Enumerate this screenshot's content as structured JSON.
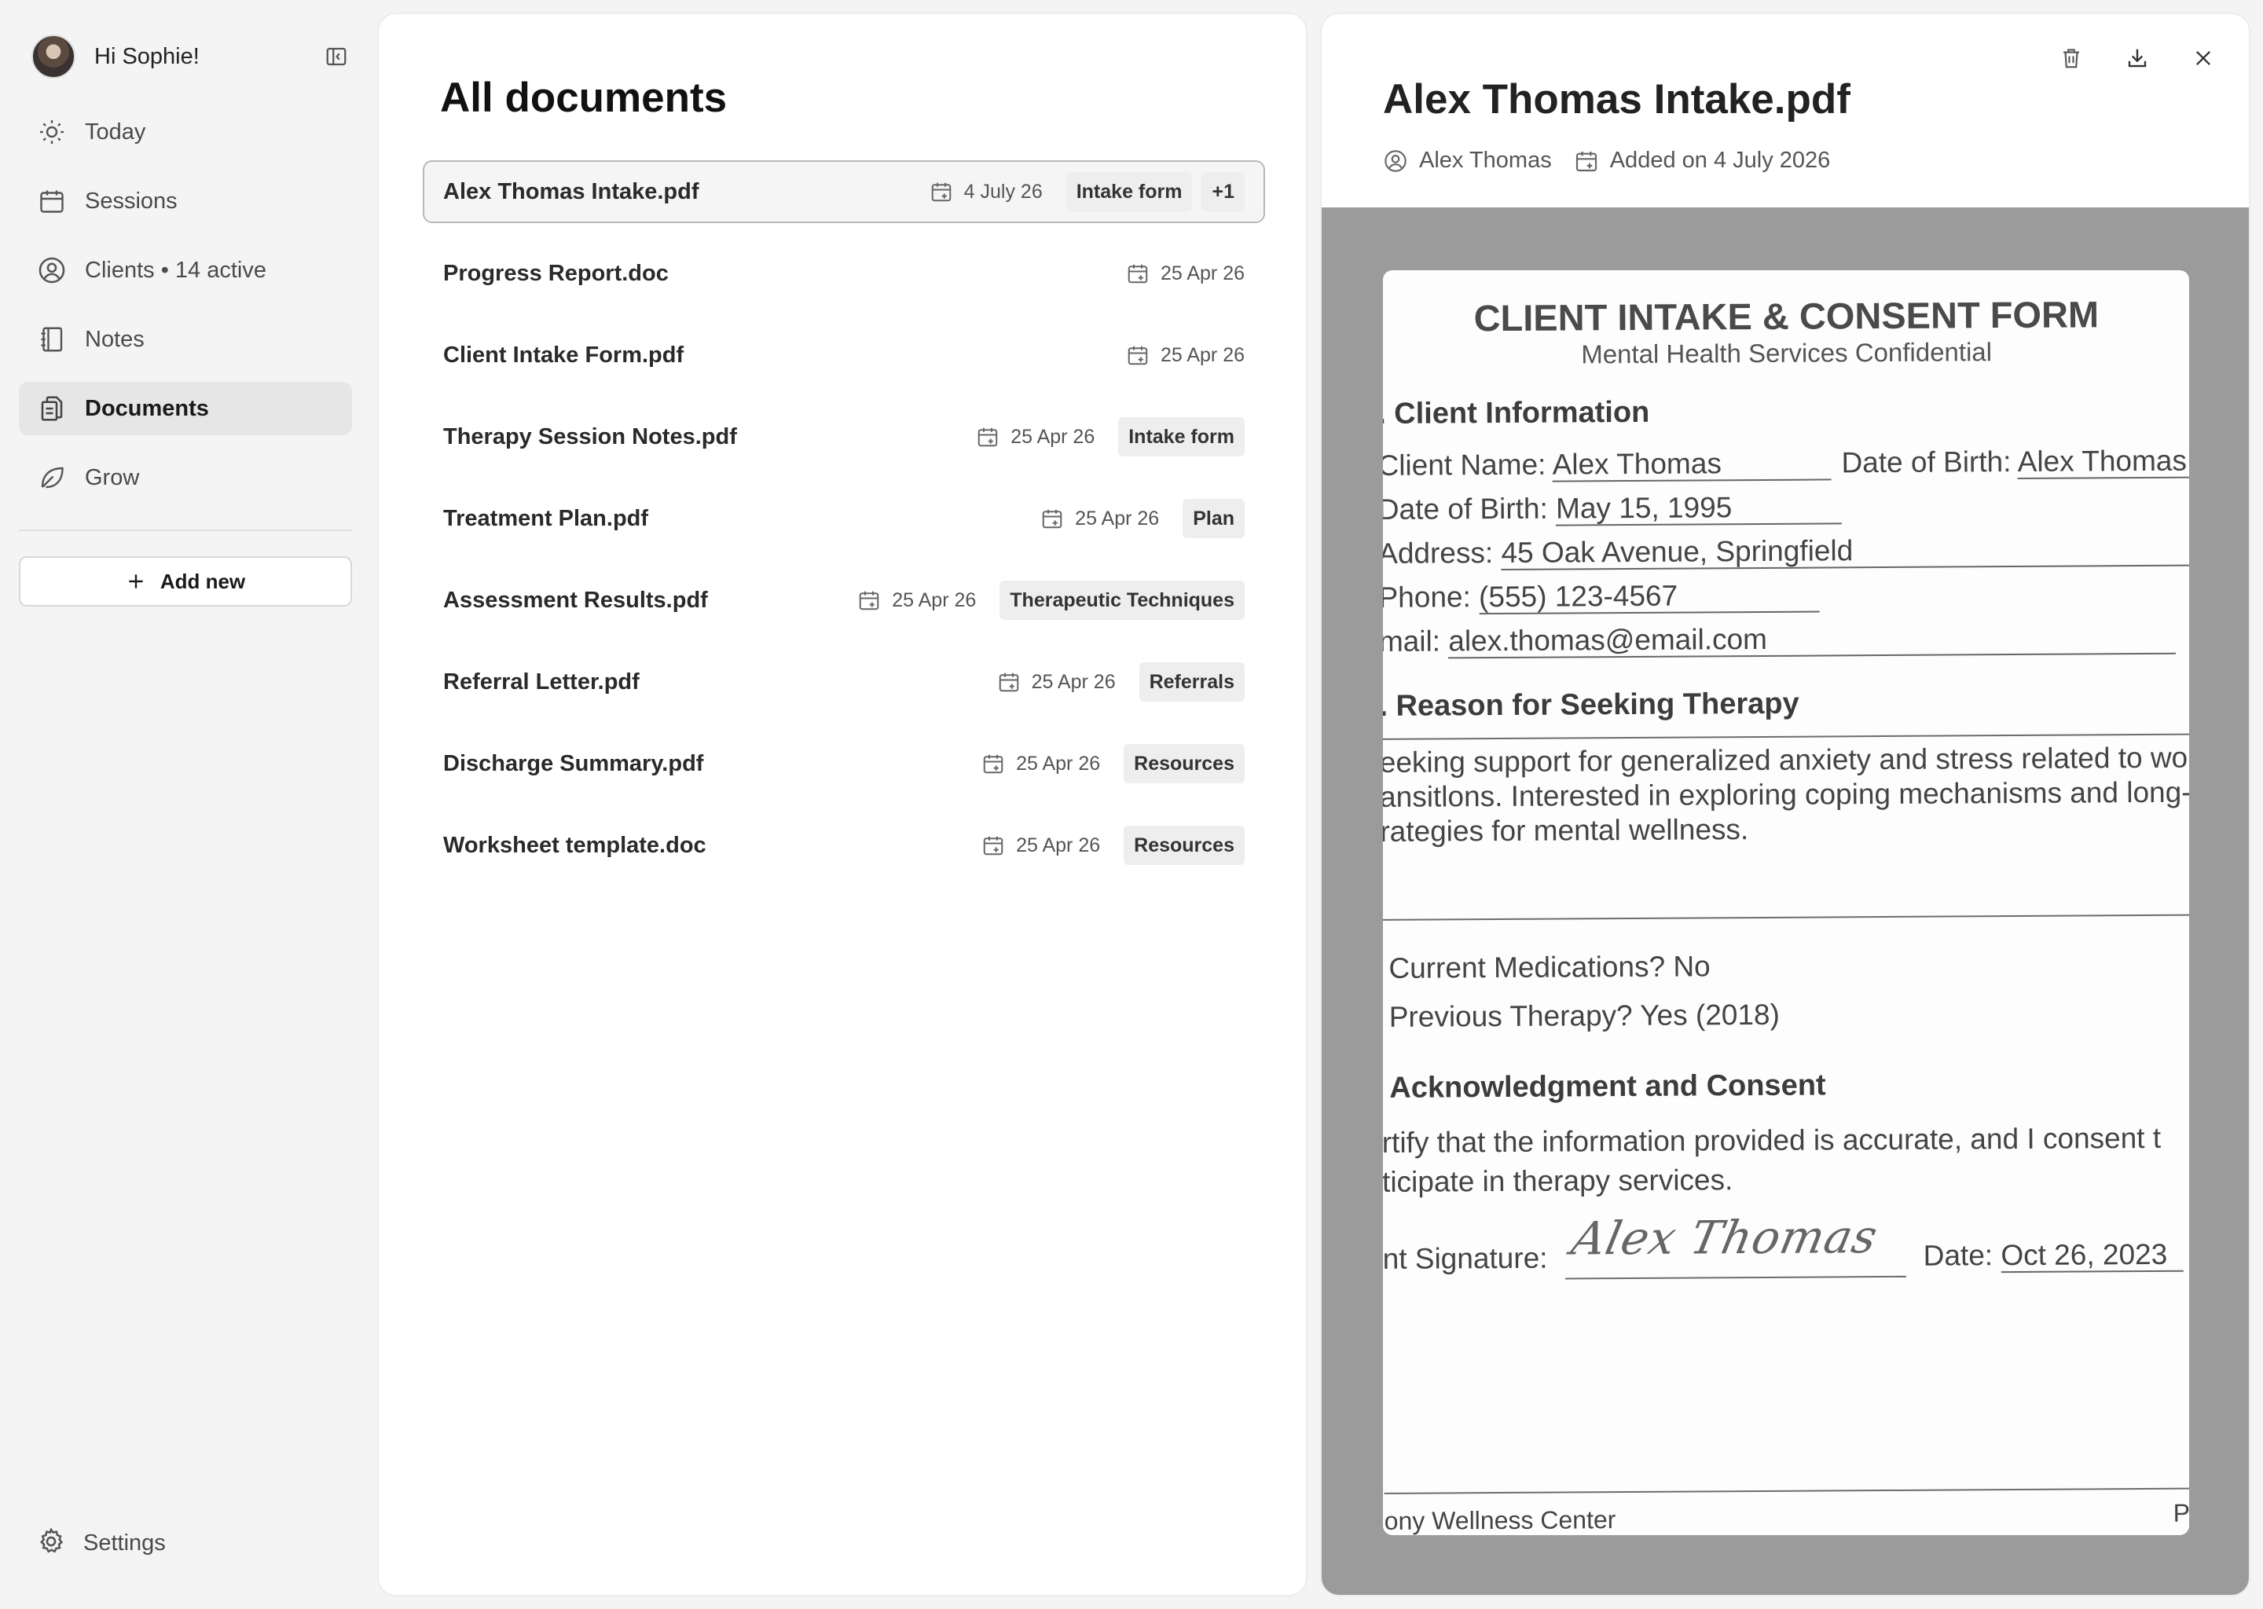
{
  "sidebar": {
    "greeting": "Hi Sophie!",
    "nav": [
      {
        "label": "Today",
        "icon": "sun-icon"
      },
      {
        "label": "Sessions",
        "icon": "calendar-icon"
      },
      {
        "label": "Clients • 14 active",
        "icon": "user-circle-icon"
      },
      {
        "label": "Notes",
        "icon": "notebook-icon"
      },
      {
        "label": "Documents",
        "icon": "documents-icon",
        "active": true
      },
      {
        "label": "Grow",
        "icon": "leaf-icon"
      }
    ],
    "add_new_label": "Add new",
    "settings_label": "Settings"
  },
  "list": {
    "title": "All documents",
    "documents": [
      {
        "name": "Alex Thomas Intake.pdf",
        "date": "4 July 26",
        "tags": [
          "Intake form",
          "+1"
        ],
        "selected": true
      },
      {
        "name": "Progress Report.doc",
        "date": "25 Apr 26",
        "tags": []
      },
      {
        "name": "Client Intake Form.pdf",
        "date": "25 Apr 26",
        "tags": []
      },
      {
        "name": "Therapy Session Notes.pdf",
        "date": "25 Apr 26",
        "tags": [
          "Intake form"
        ]
      },
      {
        "name": "Treatment Plan.pdf",
        "date": "25 Apr 26",
        "tags": [
          "Plan"
        ]
      },
      {
        "name": "Assessment Results.pdf",
        "date": "25 Apr 26",
        "tags": [
          "Therapeutic Techniques"
        ]
      },
      {
        "name": "Referral Letter.pdf",
        "date": "25 Apr 26",
        "tags": [
          "Referrals"
        ]
      },
      {
        "name": "Discharge Summary.pdf",
        "date": "25 Apr 26",
        "tags": [
          "Resources"
        ]
      },
      {
        "name": "Worksheet template.doc",
        "date": "25 Apr 26",
        "tags": [
          "Resources"
        ]
      }
    ]
  },
  "preview": {
    "title": "Alex Thomas Intake.pdf",
    "client": "Alex Thomas",
    "added": "Added on 4 July 2026",
    "scan": {
      "title": "CLIENT INTAKE & CONSENT FORM",
      "subtitle": "Mental Health Services Confidential",
      "section1": ". Client Information",
      "client_name_label": "Client Name:",
      "client_name": "Alex Thomas",
      "dob_label_right": "Date of Birth:",
      "dob_value_right": "Alex Thomas",
      "dob_label": "Date of Birth:",
      "dob": "May 15, 1995",
      "address_label": "Address:",
      "address": "45 Oak Avenue, Springfield",
      "phone_label": "Phone:",
      "phone": "(555) 123-4567",
      "email_label": "mail:",
      "email": "alex.thomas@email.com",
      "section2": ". Reason for Seeking Therapy",
      "reason_1": "eeking support for generalized anxiety and stress related to wor",
      "reason_2": "ansitlons. Interested in exploring coping mechanisms and long-t",
      "reason_3": "rategies for mental wellness.",
      "medications": "Current Medications? No",
      "previous": "Previous Therapy? Yes (2018)",
      "section3": "Acknowledgment and Consent",
      "consent_1": "rtify that the information provided is accurate, and I consent t",
      "consent_2": "ticipate in therapy services.",
      "signature_label": "nt Signature:",
      "signature": "Alex Thomas",
      "date_label": "Date:",
      "date_value": "Oct 26, 2023",
      "footer_left": "ony Wellness Center",
      "footer_right": "Pag"
    }
  },
  "colors": {
    "background": "#f4f4f4",
    "panel": "#ffffff",
    "active_nav": "#e6e6e6",
    "tag_bg": "#eeeeee",
    "viewer_bg": "#9b9b9b"
  }
}
